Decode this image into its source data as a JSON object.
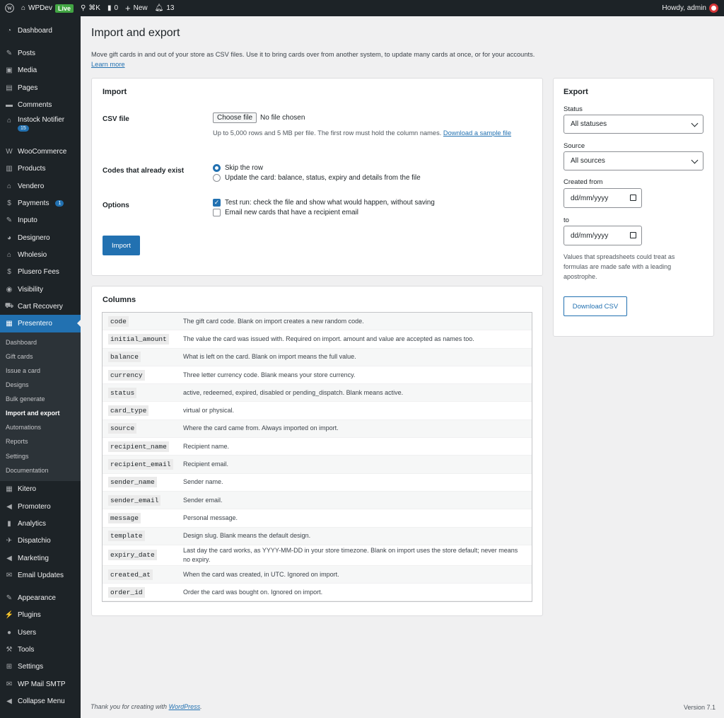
{
  "adminbar": {
    "site": "WPDev",
    "live": "Live",
    "search_shortcut": "⌘K",
    "comments": "0",
    "new": "New",
    "notifications": "13",
    "howdy": "Howdy, admin"
  },
  "sidebar": {
    "items_top": [
      {
        "label": "Dashboard",
        "icon": "dashboard-icon"
      },
      {
        "label": "Posts",
        "icon": "pin-icon"
      },
      {
        "label": "Media",
        "icon": "media-icon"
      },
      {
        "label": "Pages",
        "icon": "pages-icon"
      },
      {
        "label": "Comments",
        "icon": "comment-icon"
      }
    ],
    "instock": {
      "label": "Instock Notifier",
      "badge": "15"
    },
    "items_mid": [
      {
        "label": "WooCommerce"
      },
      {
        "label": "Products"
      },
      {
        "label": "Vendero"
      }
    ],
    "payments": {
      "label": "Payments",
      "badge": "1"
    },
    "items_mid2": [
      {
        "label": "Inputo"
      },
      {
        "label": "Designero"
      },
      {
        "label": "Wholesio"
      },
      {
        "label": "Plusero Fees"
      },
      {
        "label": "Visibility"
      },
      {
        "label": "Cart Recovery"
      }
    ],
    "current": "Presentero",
    "submenu": [
      "Dashboard",
      "Gift cards",
      "Issue a card",
      "Designs",
      "Bulk generate",
      "Import and export",
      "Automations",
      "Reports",
      "Settings",
      "Documentation"
    ],
    "items_bottom": [
      "Kitero",
      "Promotero",
      "Analytics",
      "Dispatchio",
      "Marketing",
      "Email Updates"
    ],
    "items_bottom2": [
      "Appearance",
      "Plugins",
      "Users",
      "Tools",
      "Settings",
      "WP Mail SMTP",
      "Collapse Menu"
    ]
  },
  "page": {
    "title": "Import and export",
    "intro": "Move gift cards in and out of your store as CSV files. Use it to bring cards over from another system, to update many cards at once, or for your accounts.",
    "learn_more": "Learn more"
  },
  "import": {
    "heading": "Import",
    "csv_label": "CSV file",
    "choose_file": "Choose file",
    "no_file": "No file chosen",
    "help": "Up to 5,000 rows and 5 MB per file. The first row must hold the column names.",
    "sample_link_1": "Download a",
    "sample_link_2": "sample file",
    "existing_label": "Codes that already exist",
    "opt_skip": "Skip the row",
    "opt_update": "Update the card: balance, status, expiry and details from the file",
    "options_label": "Options",
    "opt_test": "Test run: check the file and show what would happen, without saving",
    "opt_email": "Email new cards that have a recipient email",
    "button": "Import"
  },
  "export": {
    "heading": "Export",
    "status_label": "Status",
    "status_value": "All statuses",
    "source_label": "Source",
    "source_value": "All sources",
    "from_label": "Created from",
    "from_value": "dd/mm/yyyy",
    "to_label": "to",
    "to_value": "dd/mm/yyyy",
    "note": "Values that spreadsheets could treat as formulas are made safe with a leading apostrophe.",
    "button": "Download CSV"
  },
  "columns": {
    "heading": "Columns",
    "rows": [
      {
        "k": "code",
        "v": "The gift card code. Blank on import creates a new random code."
      },
      {
        "k": "initial_amount",
        "v": "The value the card was issued with. Required on import. amount and value are accepted as names too."
      },
      {
        "k": "balance",
        "v": "What is left on the card. Blank on import means the full value."
      },
      {
        "k": "currency",
        "v": "Three letter currency code. Blank means your store currency."
      },
      {
        "k": "status",
        "v": "active, redeemed, expired, disabled or pending_dispatch. Blank means active."
      },
      {
        "k": "card_type",
        "v": "virtual or physical."
      },
      {
        "k": "source",
        "v": "Where the card came from. Always imported on import."
      },
      {
        "k": "recipient_name",
        "v": "Recipient name."
      },
      {
        "k": "recipient_email",
        "v": "Recipient email."
      },
      {
        "k": "sender_name",
        "v": "Sender name."
      },
      {
        "k": "sender_email",
        "v": "Sender email."
      },
      {
        "k": "message",
        "v": "Personal message."
      },
      {
        "k": "template",
        "v": "Design slug. Blank means the default design."
      },
      {
        "k": "expiry_date",
        "v": "Last day the card works, as YYYY-MM-DD in your store timezone. Blank on import uses the store default; never means no expiry."
      },
      {
        "k": "created_at",
        "v": "When the card was created, in UTC. Ignored on import."
      },
      {
        "k": "order_id",
        "v": "Order the card was bought on. Ignored on import."
      }
    ]
  },
  "footer": {
    "thanks": "Thank you for creating with",
    "wp": "WordPress",
    "version": "Version 7.1"
  }
}
